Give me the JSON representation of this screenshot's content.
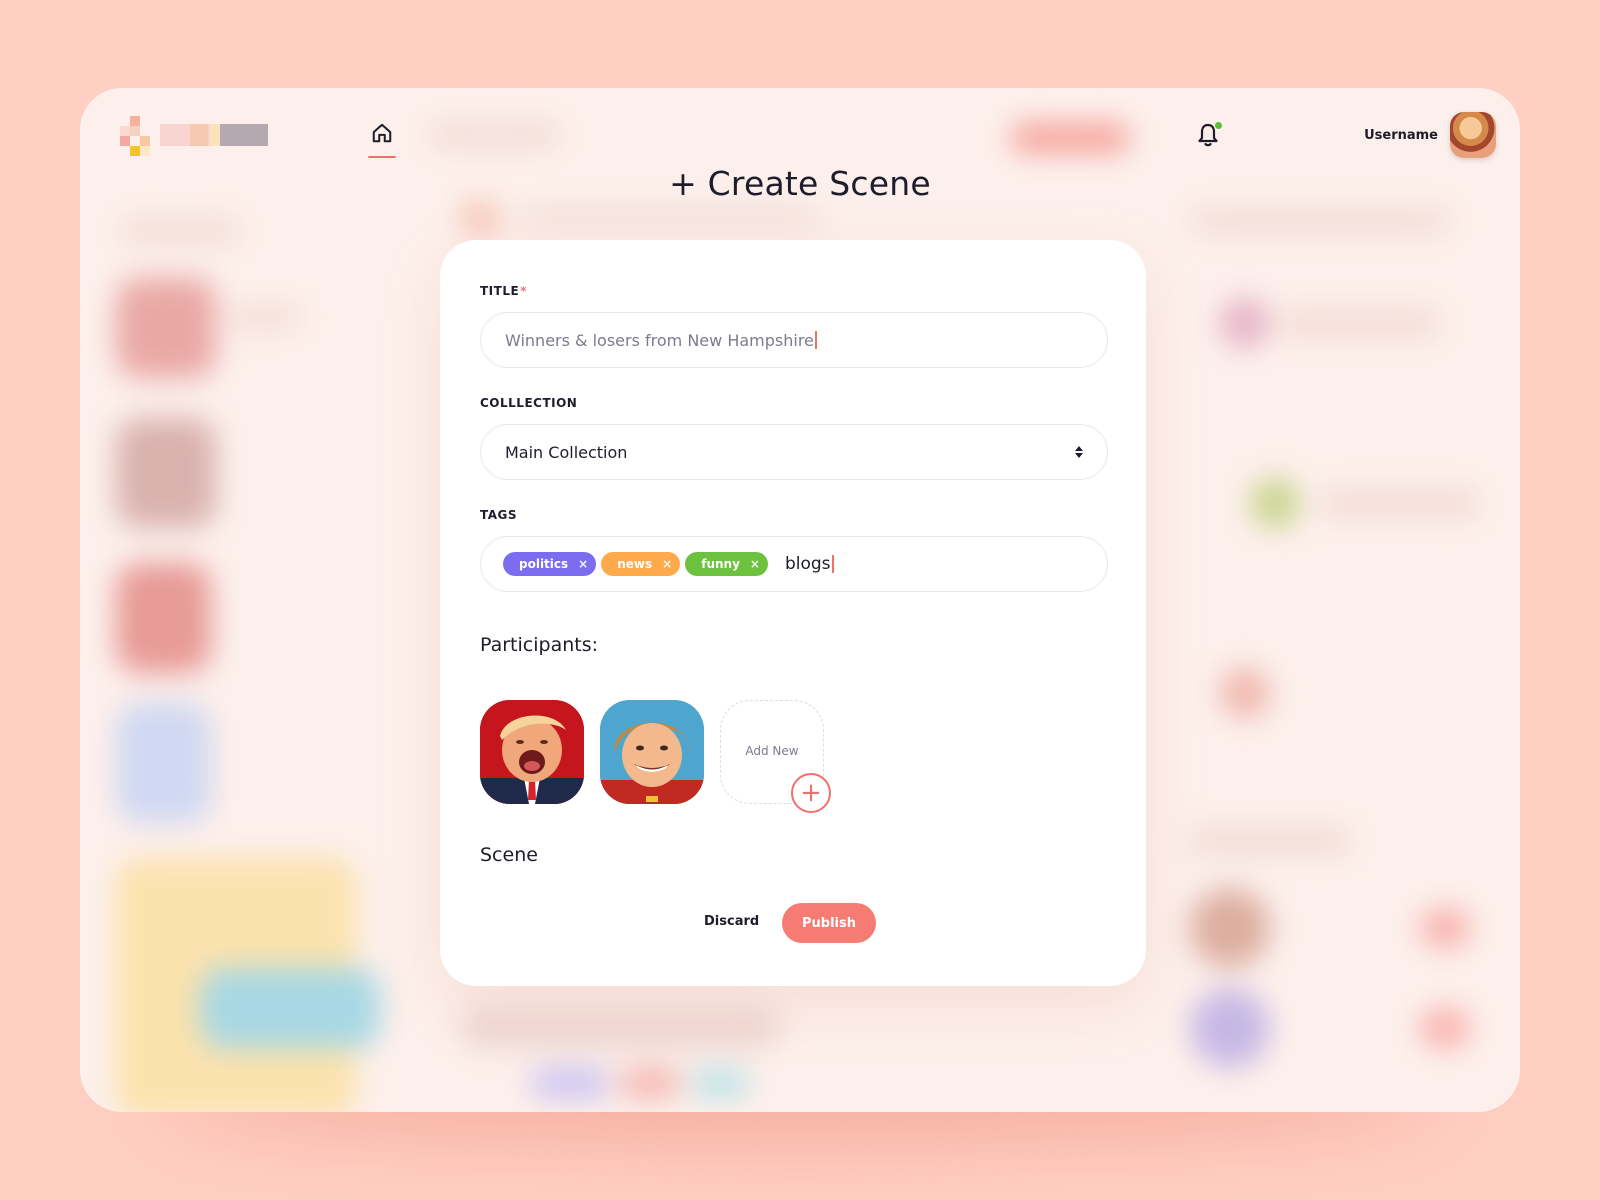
{
  "header": {
    "username": "Username"
  },
  "modal": {
    "title": "+ Create Scene",
    "title_field": {
      "label": "TITLE",
      "required_mark": "*",
      "value": "Winners & losers from New Hampshire"
    },
    "collection_field": {
      "label": "COLLLECTION",
      "selected": "Main Collection"
    },
    "tags_field": {
      "label": "TAGS",
      "tags": [
        {
          "label": "politics",
          "color": "#7c6cf0"
        },
        {
          "label": "news",
          "color": "#ffa94d"
        },
        {
          "label": "funny",
          "color": "#6cc13e"
        }
      ],
      "remove_glyph": "×",
      "input_value": "blogs"
    },
    "participants": {
      "heading": "Participants:",
      "add_new_label": "Add New",
      "add_glyph": "+"
    },
    "scene_heading": "Scene",
    "discard_label": "Discard",
    "publish_label": "Publish"
  },
  "colors": {
    "background": "#ffcfc3",
    "accent": "#f57b73",
    "notification_dot": "#58c12b"
  }
}
